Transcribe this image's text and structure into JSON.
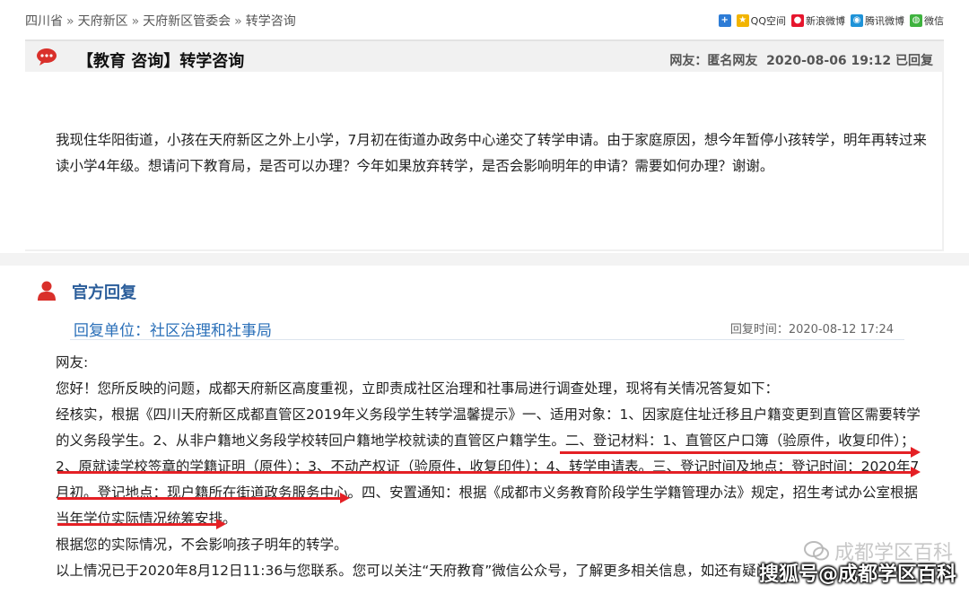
{
  "breadcrumb": [
    "四川省",
    "天府新区",
    "天府新区管委会",
    "转学咨询"
  ],
  "breadcrumb_sep": "»",
  "share": [
    {
      "label": "",
      "icon": "plus-icon",
      "color": "#2d7cd6"
    },
    {
      "label": "QQ空间",
      "icon": "qzone-icon",
      "color": "#f2b400"
    },
    {
      "label": "新浪微博",
      "icon": "weibo-icon",
      "color": "#e6162d"
    },
    {
      "label": "腾讯微博",
      "icon": "tencent-weibo-icon",
      "color": "#1f93d8"
    },
    {
      "label": "微信",
      "icon": "wechat-icon",
      "color": "#3fb33f"
    }
  ],
  "question": {
    "title": "【教育 咨询】转学咨询",
    "meta_label": "网友：",
    "meta_user": "匿名网友",
    "meta_time": "2020-08-06 19:12",
    "meta_status": "已回复",
    "body": "我现住华阳街道，小孩在天府新区之外上小学，7月初在街道办政务中心递交了转学申请。由于家庭原因，想今年暂停小孩转学，明年再转过来读小学4年级。想请问下教育局，是否可以办理？今年如果放弃转学，是否会影响明年的申请？需要如何办理？谢谢。"
  },
  "answer": {
    "title": "官方回复",
    "unit": "回复单位：社区治理和社事局",
    "time": "回复时间：2020-08-12 17:24",
    "paragraphs": [
      "网友:",
      "您好！您所反映的问题，成都天府新区高度重视，立即责成社区治理和社事局进行调查处理，现将有关情况答复如下：",
      "经核实，根据《四川天府新区成都直管区2019年义务段学生转学温馨提示》一、适用对象：1、因家庭住址迁移且户籍变更到直管区需要转学的义务段学生。2、从非户籍地义务段学校转回户籍地学校就读的直管区户籍学生。二、登记材料：1、直管区户口簿（验原件，收复印件）；2、原就读学校签章的学籍证明（原件）；3、不动产权证（验原件，收复印件）；4、转学申请表。三、登记时间及地点：登记时间：2020年7月初。登记地点：现户籍所在街道政务服务中心。四、安置通知：根据《成都市义务教育阶段学生学籍管理办法》规定，招生考试办公室根据当年学位实际情况统筹安排。",
      "根据您的实际情况，不会影响孩子明年的转学。",
      "以上情况已于2020年8月12日11:36与您联系。您可以关注“天府教育”微信公众号，了解更多相关信息，如还有疑问"
    ]
  },
  "watermark": {
    "main": "成都学区百科",
    "sub": "搜狐号@成都学区百科"
  },
  "colors": {
    "accent_blue": "#2a6fb8",
    "arrow_red": "#e42025",
    "icon_red": "#d9302b"
  }
}
